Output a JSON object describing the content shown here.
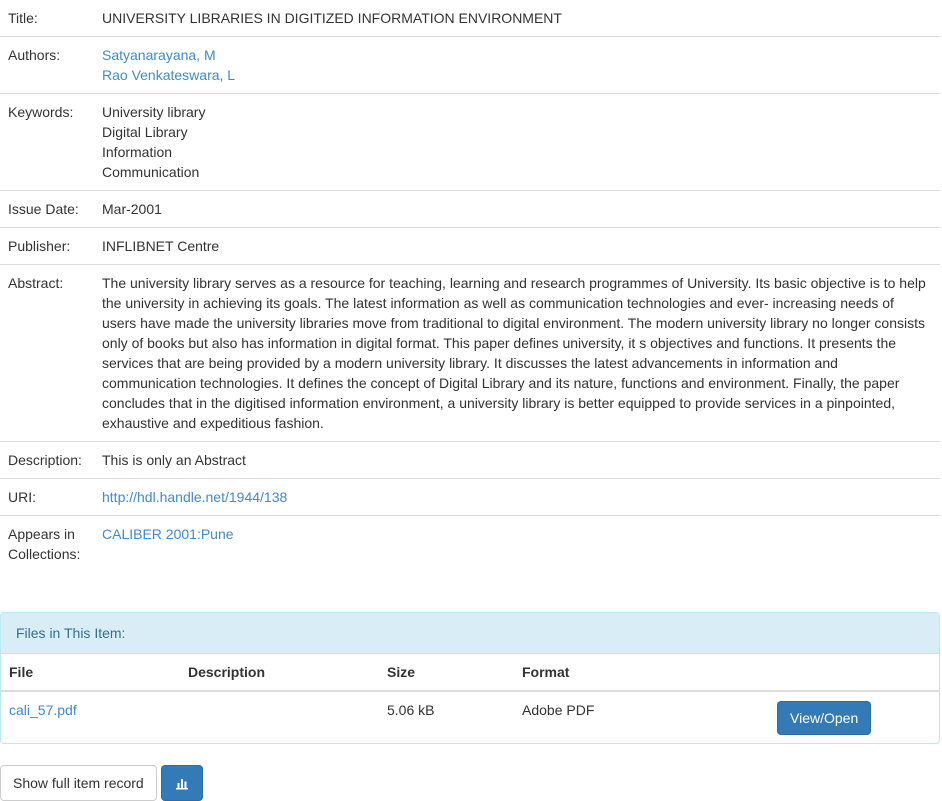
{
  "record": {
    "title_label": "Title:",
    "title": "UNIVERSITY LIBRARIES IN DIGITIZED INFORMATION ENVIRONMENT",
    "authors_label": "Authors:",
    "authors": [
      "Satyanarayana, M",
      "Rao Venkateswara, L"
    ],
    "keywords_label": "Keywords:",
    "keywords": [
      "University library",
      "Digital Library",
      "Information",
      "Communication"
    ],
    "issue_date_label": "Issue Date:",
    "issue_date": "Mar-2001",
    "publisher_label": "Publisher:",
    "publisher": "INFLIBNET Centre",
    "abstract_label": "Abstract:",
    "abstract": "The university library serves as a resource for teaching, learning and research programmes of University. Its basic objective is to help the university in achieving its goals. The latest information as well as communication technologies and ever- increasing needs of users have made the university libraries move from traditional to digital environment. The modern university library no longer consists only of books but also has information in digital format. This paper defines university, it s objectives and functions. It presents the services that are being provided by a modern university library. It discusses the latest advancements in information and communication technologies. It defines the concept of Digital Library and its nature, functions and environment. Finally, the paper concludes that in the digitised information environment, a university library is better equipped to provide services in a pinpointed, exhaustive and expeditious fashion.",
    "description_label": "Description:",
    "description": "This is only an Abstract",
    "uri_label": "URI:",
    "uri": "http://hdl.handle.net/1944/138",
    "collections_label": "Appears in Collections:",
    "collection": "CALIBER 2001:Pune"
  },
  "files": {
    "heading": "Files in This Item:",
    "columns": [
      "File",
      "Description",
      "Size",
      "Format"
    ],
    "rows": [
      {
        "file": "cali_57.pdf",
        "description": "",
        "size": "5.06 kB",
        "format": "Adobe PDF",
        "action": "View/Open"
      }
    ]
  },
  "footer": {
    "show_full_label": "Show full item record",
    "stats_icon": "bar-chart-icon"
  }
}
